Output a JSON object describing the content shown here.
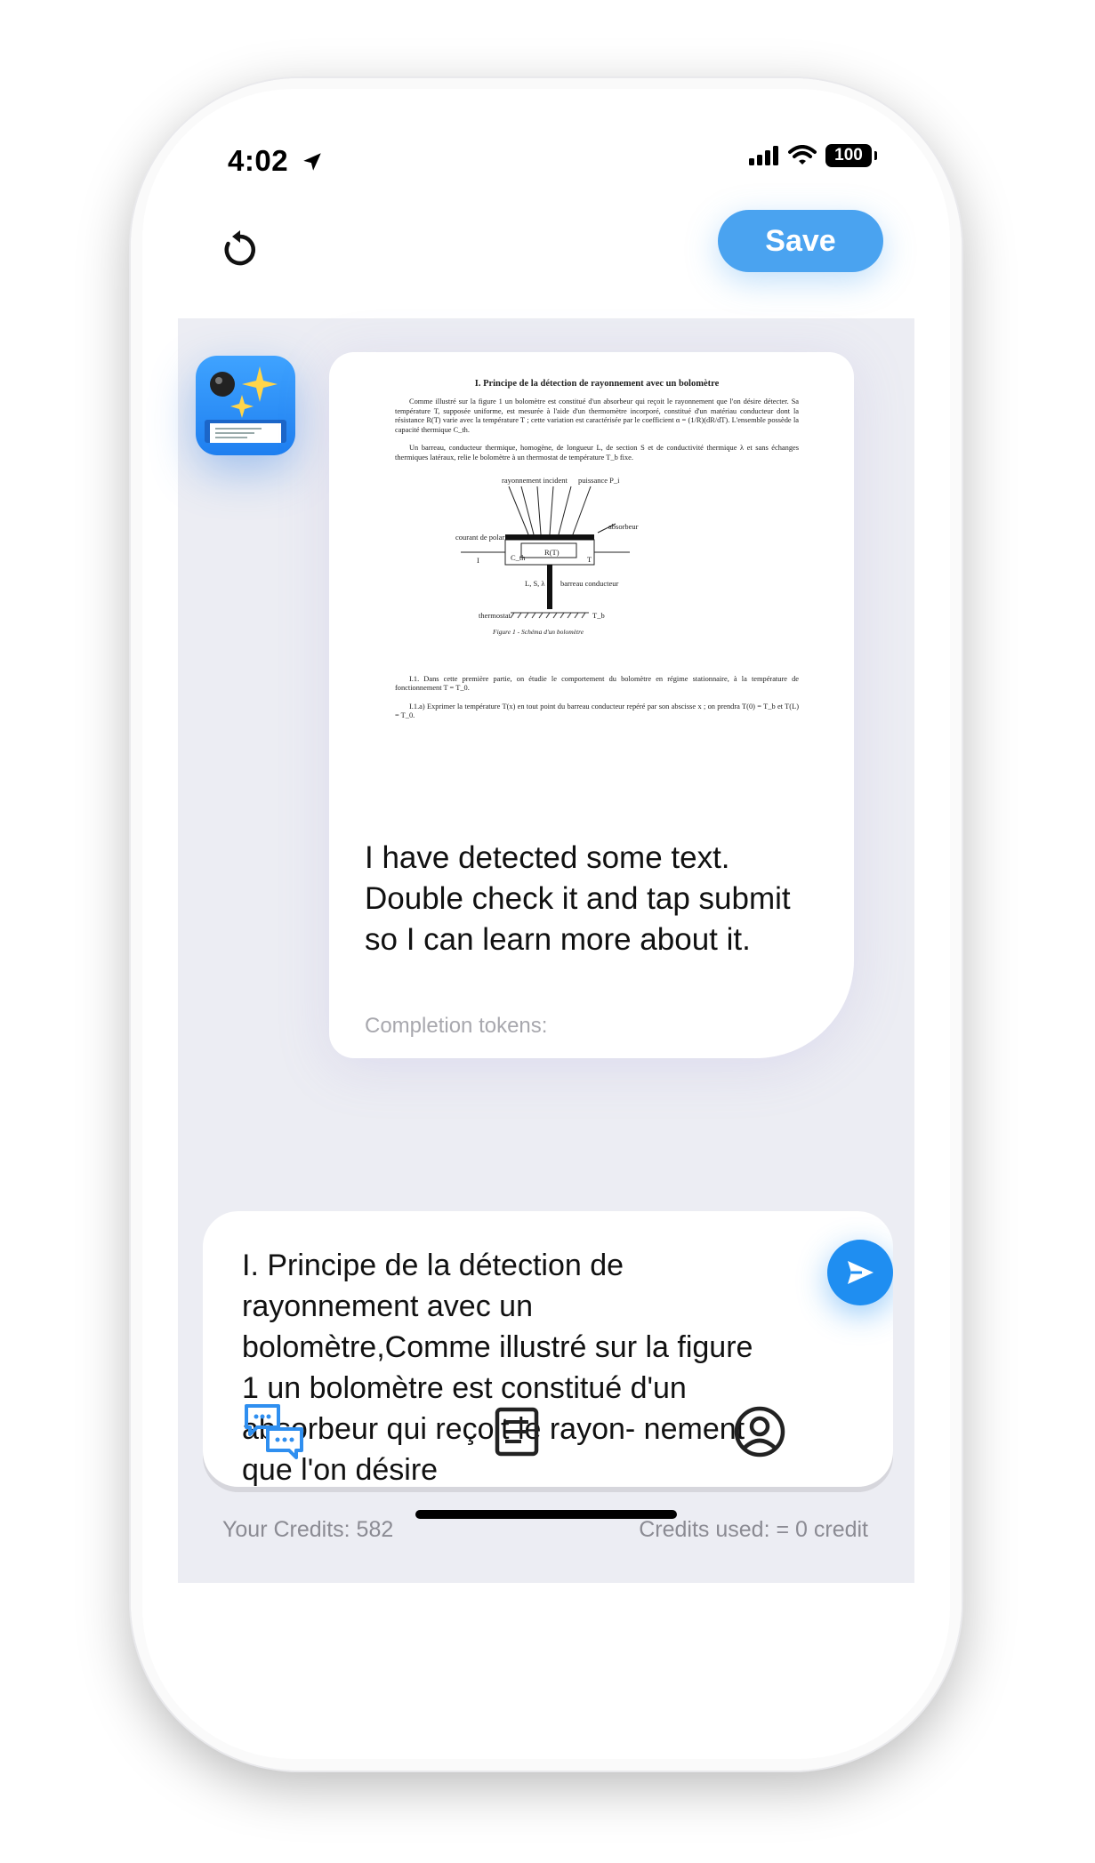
{
  "status_bar": {
    "time": "4:02",
    "battery": "100"
  },
  "header": {
    "save_label": "Save"
  },
  "message": {
    "document": {
      "title": "I. Principe de la détection de rayonnement avec un bolomètre",
      "paragraphs": [
        "Comme illustré sur la figure 1 un bolomètre est constitué d'un absorbeur qui reçoit le rayonnement que l'on désire détecter. Sa température T, supposée uniforme, est mesurée à l'aide d'un thermomètre incorporé, constitué d'un matériau conducteur dont la résistance R(T) varie avec la température T ; cette variation est caractérisée par le coefficient α = (1/R)(dR/dT). L'ensemble possède la capacité thermique C_th.",
        "Un barreau, conducteur thermique, homogène, de longueur L, de section S et de conductivité thermique λ et sans échanges thermiques latéraux, relie le bolomètre à un thermostat de température T_b fixe."
      ],
      "figure": {
        "label_incident": "rayonnement incident",
        "label_power": "puissance P_i",
        "label_absorber": "absorbeur",
        "label_current": "courant de polarisation",
        "label_I": "I",
        "label_cth": "C_th",
        "label_rt": "R(T)",
        "label_t": "T",
        "label_lsl": "L, S, λ",
        "label_bar": "barreau conducteur",
        "label_thermostat": "thermostat",
        "label_tb": "T_b",
        "caption": "Figure 1 - Schéma d'un bolomètre"
      },
      "post_paragraphs": [
        "I.1. Dans cette première partie, on étudie le comportement du bolomètre en régime stationnaire, à la température de fonctionnement T = T_0.",
        "I.1.a) Exprimer la température T(x) en tout point du barreau conducteur repéré par son abscisse x ; on prendra T(0) = T_b et T(L) = T_0."
      ]
    },
    "text": "I have detected some text. Double check it and tap submit so I can learn more about it.",
    "tokens_label": "Completion tokens:"
  },
  "input": {
    "text": "I. Principe de la détection de rayonnement avec un bolomètre,Comme illustré sur la figure 1 un bolomètre est constitué d'un absorbeur qui reçoit le rayon- nement que l'on désire"
  },
  "footer": {
    "credits_left": "Your Credits: 582",
    "credits_right": "Credits used: = 0 credit"
  },
  "tabs": [
    {
      "icon": "chat-bubbles-icon",
      "active": true
    },
    {
      "icon": "document-icon",
      "active": false
    },
    {
      "icon": "profile-icon",
      "active": false
    }
  ],
  "colors": {
    "accent": "#1f8ef1",
    "save": "#4aa3f0",
    "chat_bg": "#ecedf3"
  }
}
